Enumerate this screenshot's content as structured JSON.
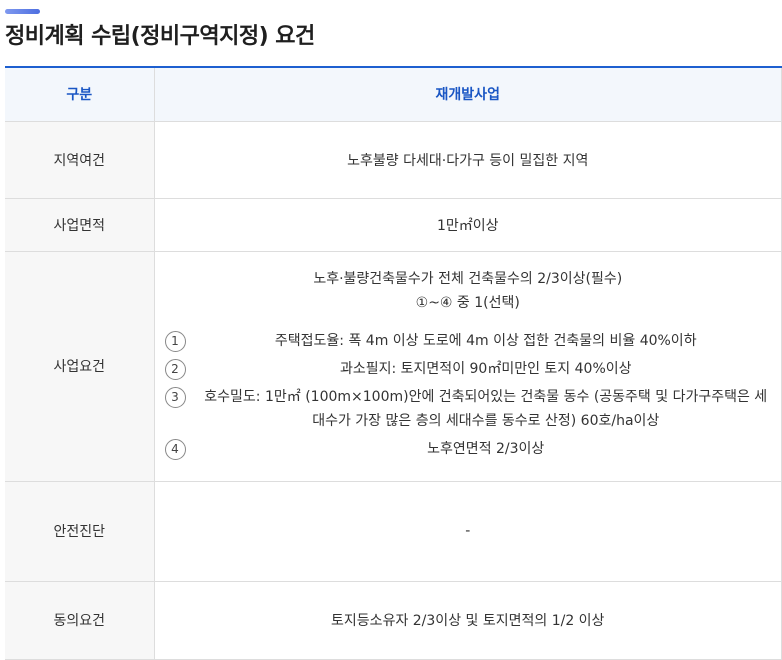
{
  "page": {
    "title": "정비계획 수립(정비구역지정) 요건"
  },
  "table": {
    "header": {
      "category": "구분",
      "project": "재개발사업"
    },
    "rows": [
      {
        "label": "지역여건",
        "value": "노후불량 다세대·다가구 등이 밀집한 지역"
      },
      {
        "label": "사업면적",
        "value": "1만㎡이상"
      },
      {
        "label": "사업요건",
        "main": "노후·불량건축물수가 전체 건축물수의 2/3이상(필수)",
        "sub": "①~④ 중 1(선택)",
        "items": [
          {
            "num": "1",
            "text": "주택접도율: 폭 4m 이상 도로에 4m 이상 접한 건축물의 비율 40%이하"
          },
          {
            "num": "2",
            "text": "과소필지: 토지면적이 90㎡미만인 토지 40%이상"
          },
          {
            "num": "3",
            "text": "호수밀도: 1만㎡ (100m×100m)안에 건축되어있는 건축물 동수 (공동주택 및 다가구주택은 세대수가 가장 많은 층의 세대수를 동수로 산정) 60호/ha이상"
          },
          {
            "num": "4",
            "text": "노후연면적 2/3이상"
          }
        ]
      },
      {
        "label": "안전진단",
        "value": "-"
      },
      {
        "label": "동의요건",
        "value": "토지등소유자 2/3이상 및 토지면적의 1/2 이상"
      }
    ]
  }
}
